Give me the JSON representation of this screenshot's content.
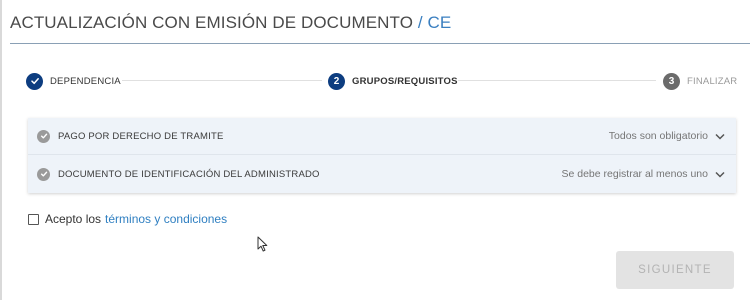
{
  "header": {
    "title": "ACTUALIZACIÓN CON EMISIÓN DE DOCUMENTO",
    "separator": "/",
    "code": "CE"
  },
  "stepper": {
    "steps": [
      {
        "number": "1",
        "label": "DEPENDENCIA",
        "state": "done"
      },
      {
        "number": "2",
        "label": "GRUPOS/REQUISITOS",
        "state": "active"
      },
      {
        "number": "3",
        "label": "FINALIZAR",
        "state": "pending"
      }
    ]
  },
  "requirements": [
    {
      "title": "PAGO POR DERECHO DE TRAMITE",
      "status": "Todos son obligatorio"
    },
    {
      "title": "DOCUMENTO DE IDENTIFICACIÓN DEL ADMINISTRADO",
      "status": "Se debe registrar al menos uno"
    }
  ],
  "terms": {
    "prefix": "Acepto los",
    "link": "términos y condiciones",
    "checked": false
  },
  "next_button": {
    "label": "SIGUIENTE",
    "enabled": false
  },
  "colors": {
    "primary": "#0d3d80",
    "link": "#2f7fc1",
    "panel_bg": "#eef3f9"
  }
}
